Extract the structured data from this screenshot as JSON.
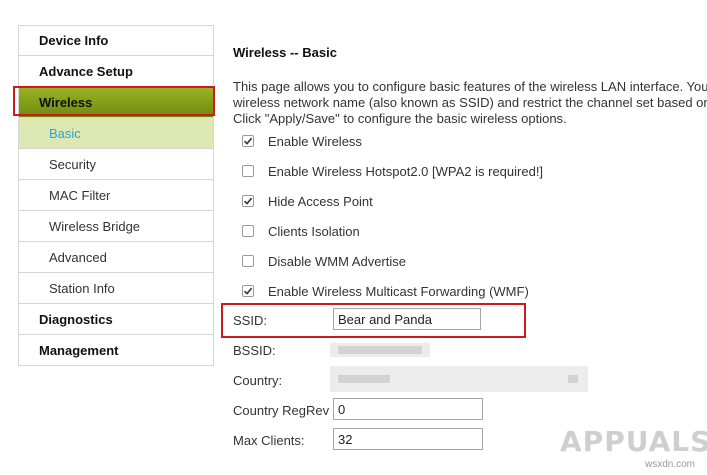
{
  "sidebar": {
    "items": [
      {
        "label": "Device Info"
      },
      {
        "label": "Advance Setup"
      },
      {
        "label": "Wireless"
      },
      {
        "label": "Basic"
      },
      {
        "label": "Security"
      },
      {
        "label": "MAC Filter"
      },
      {
        "label": "Wireless Bridge"
      },
      {
        "label": "Advanced"
      },
      {
        "label": "Station Info"
      },
      {
        "label": "Diagnostics"
      },
      {
        "label": "Management"
      }
    ]
  },
  "main": {
    "title": "Wireless -- Basic",
    "description": [
      "This page allows you to configure basic features of the wireless LAN interface. You",
      "wireless network name (also known as SSID) and restrict the channel set based on",
      "Click \"Apply/Save\" to configure the basic wireless options."
    ],
    "options": [
      {
        "label": "Enable Wireless",
        "checked": true
      },
      {
        "label": "Enable Wireless Hotspot2.0 [WPA2 is required!]",
        "checked": false
      },
      {
        "label": "Hide Access Point",
        "checked": true
      },
      {
        "label": "Clients Isolation",
        "checked": false
      },
      {
        "label": "Disable WMM Advertise",
        "checked": false
      },
      {
        "label": "Enable Wireless Multicast Forwarding (WMF)",
        "checked": true
      }
    ],
    "fields": {
      "ssid": {
        "label": "SSID:",
        "value": "Bear and Panda"
      },
      "bssid": {
        "label": "BSSID:"
      },
      "country": {
        "label": "Country:"
      },
      "country_regrev": {
        "label": "Country RegRev",
        "value": "0"
      },
      "max_clients": {
        "label": "Max Clients:",
        "value": "32"
      }
    }
  },
  "watermark": {
    "logo": "APPUALS",
    "site": "wsxdn.com"
  },
  "colors": {
    "accent_green": "#8aa31a",
    "highlight_red": "#d0181e",
    "selected_text": "#2aa6d6"
  }
}
